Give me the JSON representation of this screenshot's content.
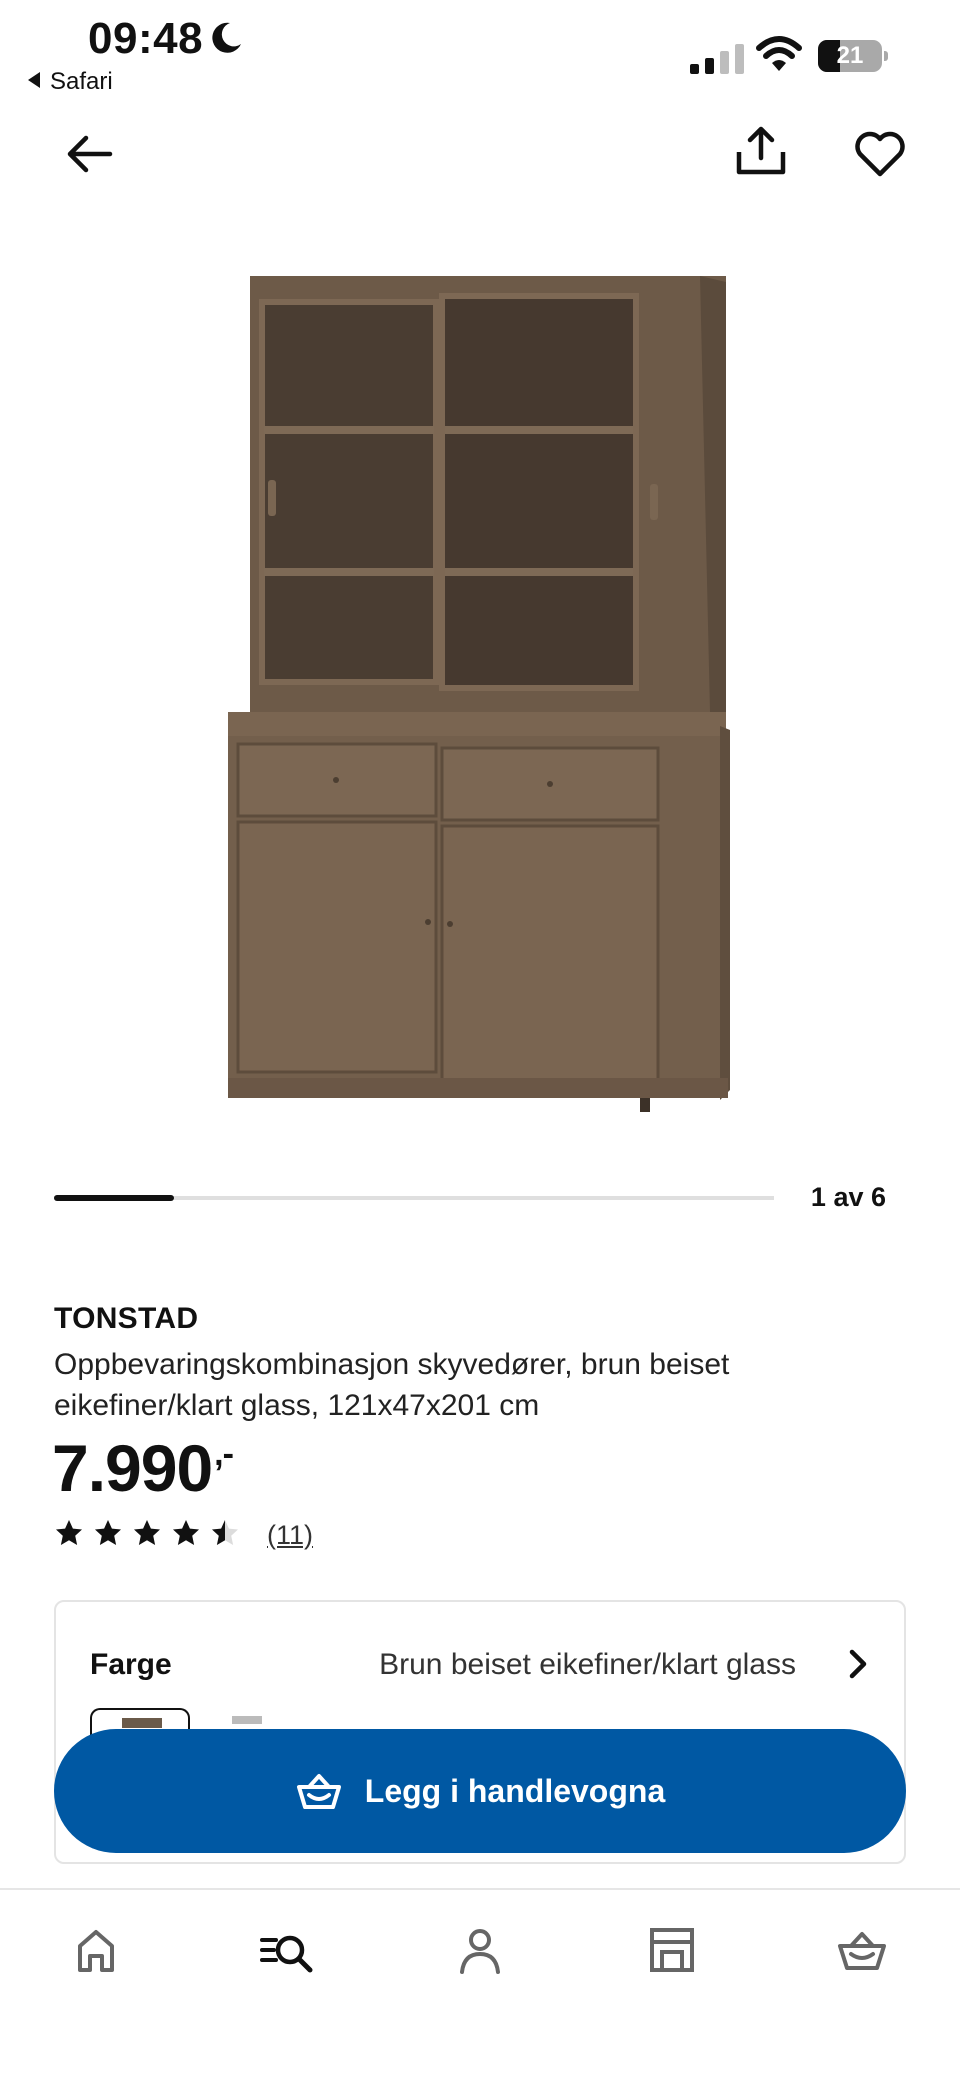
{
  "status_bar": {
    "time": "09:48",
    "back_app": "Safari",
    "battery": "21"
  },
  "top_nav": {
    "back_icon": "arrow-left-icon",
    "share_icon": "share-icon",
    "favourite_icon": "heart-icon"
  },
  "carousel": {
    "counter": "1 av 6",
    "current": 1,
    "total": 6
  },
  "product": {
    "name": "TONSTAD",
    "description": "Oppbevaringskombinasjon skyvedører, brun beiset eikefiner/klart glass, 121x47x201 cm",
    "price": "7.990",
    "price_suffix": ",-",
    "rating": 4.5,
    "review_count": "(11)"
  },
  "color": {
    "label": "Farge",
    "value": "Brun beiset eikefiner/klart glass"
  },
  "cta": {
    "label": "Legg i handlevogna",
    "color": "#0058a3"
  },
  "bottom_nav": {
    "tabs": [
      {
        "icon": "home-icon"
      },
      {
        "icon": "search-icon",
        "active": true
      },
      {
        "icon": "profile-icon"
      },
      {
        "icon": "store-icon"
      },
      {
        "icon": "cart-icon"
      }
    ]
  }
}
